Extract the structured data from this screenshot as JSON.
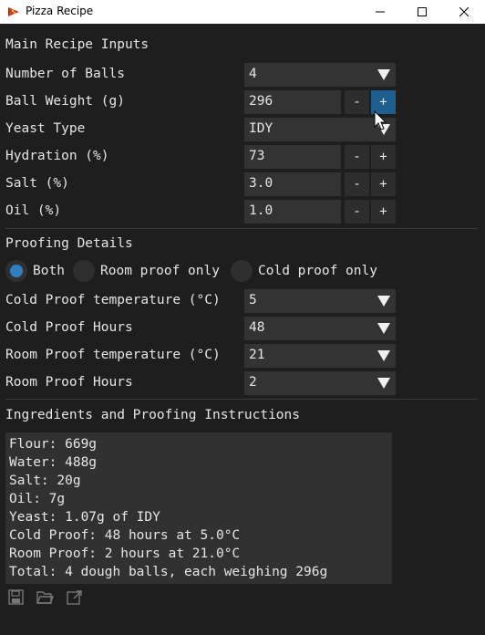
{
  "window": {
    "title": "Pizza Recipe"
  },
  "main_inputs": {
    "heading": "Main Recipe Inputs",
    "balls": {
      "label": "Number of Balls",
      "value": "4"
    },
    "ball_weight": {
      "label": "Ball Weight (g)",
      "value": "296"
    },
    "yeast_type": {
      "label": "Yeast Type",
      "value": "IDY"
    },
    "hydration": {
      "label": "Hydration (%)",
      "value": "73"
    },
    "salt": {
      "label": "Salt (%)",
      "value": "3.0"
    },
    "oil": {
      "label": "Oil (%)",
      "value": "1.0"
    },
    "minus": "-",
    "plus": "+"
  },
  "proofing": {
    "heading": "Proofing Details",
    "options": [
      {
        "label": "Both",
        "selected": true
      },
      {
        "label": "Room proof only",
        "selected": false
      },
      {
        "label": "Cold proof only",
        "selected": false
      }
    ],
    "cold_temp": {
      "label": "Cold Proof temperature (°C)",
      "value": "5"
    },
    "cold_hours": {
      "label": "Cold Proof Hours",
      "value": "48"
    },
    "room_temp": {
      "label": "Room Proof temperature (°C)",
      "value": "21"
    },
    "room_hours": {
      "label": "Room Proof Hours",
      "value": "2"
    }
  },
  "output": {
    "heading": "Ingredients and Proofing Instructions",
    "lines": [
      "Flour: 669g",
      "Water: 488g",
      "Salt: 20g",
      "Oil: 7g",
      "Yeast: 1.07g of IDY",
      "Cold Proof: 48 hours at 5.0°C",
      "Room Proof: 2 hours at 21.0°C",
      "Total: 4 dough balls, each weighing 296g"
    ]
  },
  "toolbar": {
    "icons": [
      "save-icon",
      "open-folder-icon",
      "export-icon"
    ]
  },
  "colors": {
    "background": "#1e1e1e",
    "field": "#333333",
    "accent": "#1f5f8f",
    "radio_selected": "#2e80c0"
  }
}
